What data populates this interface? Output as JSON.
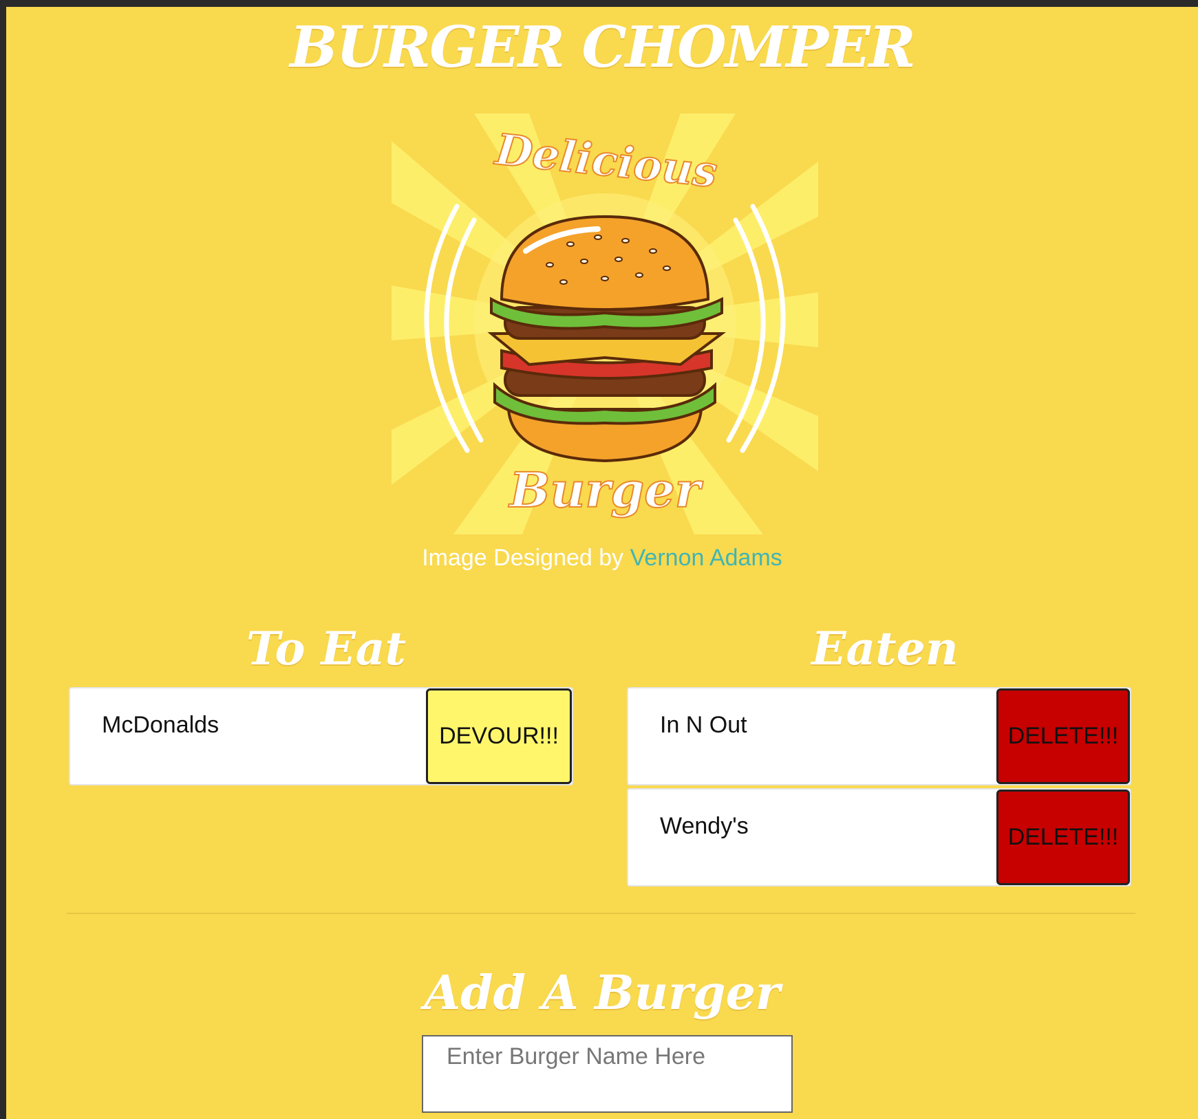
{
  "app": {
    "title": "BURGER CHOMPER"
  },
  "logo": {
    "top_text": "Delicious",
    "bottom_text": "Burger"
  },
  "credit": {
    "prefix": "Image Designed by",
    "author": "Vernon Adams"
  },
  "to_eat": {
    "heading": "To Eat",
    "items": [
      {
        "name": "McDonalds",
        "button": "DEVOUR!!!"
      }
    ]
  },
  "eaten": {
    "heading": "Eaten",
    "items": [
      {
        "name": "In N Out",
        "button": "DELETE!!!"
      },
      {
        "name": "Wendy's",
        "button": "DELETE!!!"
      }
    ]
  },
  "add_form": {
    "heading": "Add A Burger",
    "placeholder": "Enter Burger Name Here",
    "value": ""
  },
  "colors": {
    "background": "#f9d94e",
    "devour_button": "#fff66c",
    "delete_button": "#c70000",
    "link": "#3fb5b5"
  }
}
